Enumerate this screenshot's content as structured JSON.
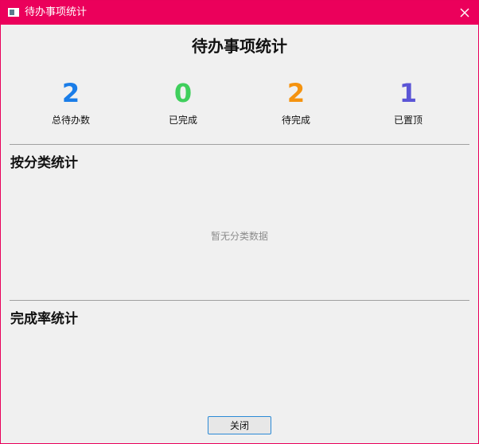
{
  "window": {
    "title": "待办事项统计"
  },
  "dialog": {
    "heading": "待办事项统计"
  },
  "stats": [
    {
      "value": "2",
      "label": "总待办数",
      "color": "#1a7de8"
    },
    {
      "value": "0",
      "label": "已完成",
      "color": "#3fcf5c"
    },
    {
      "value": "2",
      "label": "待完成",
      "color": "#f5930f"
    },
    {
      "value": "1",
      "label": "已置顶",
      "color": "#5b55d6"
    }
  ],
  "category_section": {
    "title": "按分类统计",
    "empty_text": "暂无分类数据"
  },
  "completion_section": {
    "title": "完成率统计"
  },
  "footer": {
    "close_label": "关闭"
  },
  "colors": {
    "titlebar": "#eb005b",
    "background": "#f0f0f0",
    "button_border": "#2b8ad6"
  }
}
